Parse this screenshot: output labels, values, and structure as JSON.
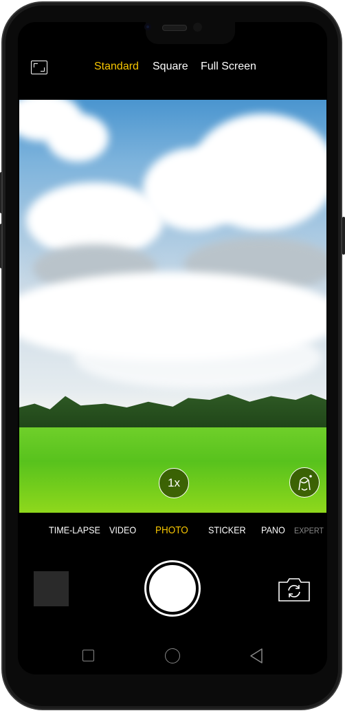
{
  "camera": {
    "aspect_ratios": [
      {
        "label": "Standard",
        "active": true
      },
      {
        "label": "Square",
        "active": false
      },
      {
        "label": "Full Screen",
        "active": false
      }
    ],
    "zoom_label": "1x",
    "modes": [
      {
        "label": "TIME-LAPSE"
      },
      {
        "label": "VIDEO"
      },
      {
        "label": "PHOTO",
        "active": true
      },
      {
        "label": "STICKER"
      },
      {
        "label": "PANO"
      },
      {
        "label": "EXPERT"
      }
    ],
    "accent_color": "#f7c600",
    "icons": [
      "aspect-ratio-icon",
      "beauty-mode-icon",
      "flip-camera-icon"
    ]
  },
  "navbar": {
    "icons": [
      "recents-icon",
      "home-icon",
      "back-icon"
    ]
  }
}
